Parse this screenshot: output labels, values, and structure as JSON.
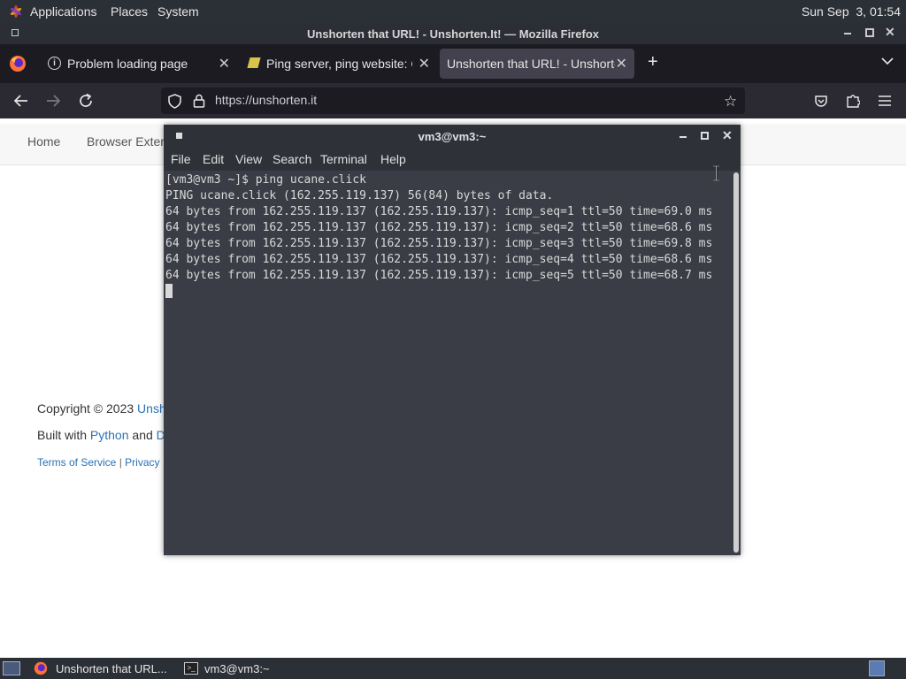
{
  "top_panel": {
    "menus": [
      "Applications",
      "Places",
      "System"
    ],
    "clock": "Sun Sep  3, 01:54"
  },
  "firefox": {
    "window_title": "Unshorten that URL! - Unshorten.It! — Mozilla Firefox",
    "tabs": [
      {
        "label": "Problem loading page",
        "active": false
      },
      {
        "label": "Ping server, ping website: Ch",
        "active": false
      },
      {
        "label": "Unshorten that URL! - Unshorten",
        "active": true
      }
    ],
    "url": "https://unshorten.it"
  },
  "page": {
    "nav": [
      "Home",
      "Browser Exter"
    ],
    "footer": {
      "copyright_prefix": "Copyright © 2023 ",
      "copyright_link": "Unsh",
      "built_prefix": "Built with ",
      "built_link1": "Python",
      "built_mid": " and ",
      "built_link2": "D",
      "terms": "Terms of Service",
      "sep": " | ",
      "privacy": "Privacy I"
    }
  },
  "terminal": {
    "title": "vm3@vm3:~",
    "menu": [
      "File",
      "Edit",
      "View",
      "Search",
      "Terminal",
      "Help"
    ],
    "lines": [
      "[vm3@vm3 ~]$ ping ucane.click",
      "PING ucane.click (162.255.119.137) 56(84) bytes of data.",
      "64 bytes from 162.255.119.137 (162.255.119.137): icmp_seq=1 ttl=50 time=69.0 ms",
      "64 bytes from 162.255.119.137 (162.255.119.137): icmp_seq=2 ttl=50 time=68.6 ms",
      "64 bytes from 162.255.119.137 (162.255.119.137): icmp_seq=3 ttl=50 time=69.8 ms",
      "64 bytes from 162.255.119.137 (162.255.119.137): icmp_seq=4 ttl=50 time=68.6 ms",
      "64 bytes from 162.255.119.137 (162.255.119.137): icmp_seq=5 ttl=50 time=68.7 ms"
    ]
  },
  "taskbar": {
    "items": [
      "Unshorten that URL...",
      "vm3@vm3:~"
    ]
  }
}
